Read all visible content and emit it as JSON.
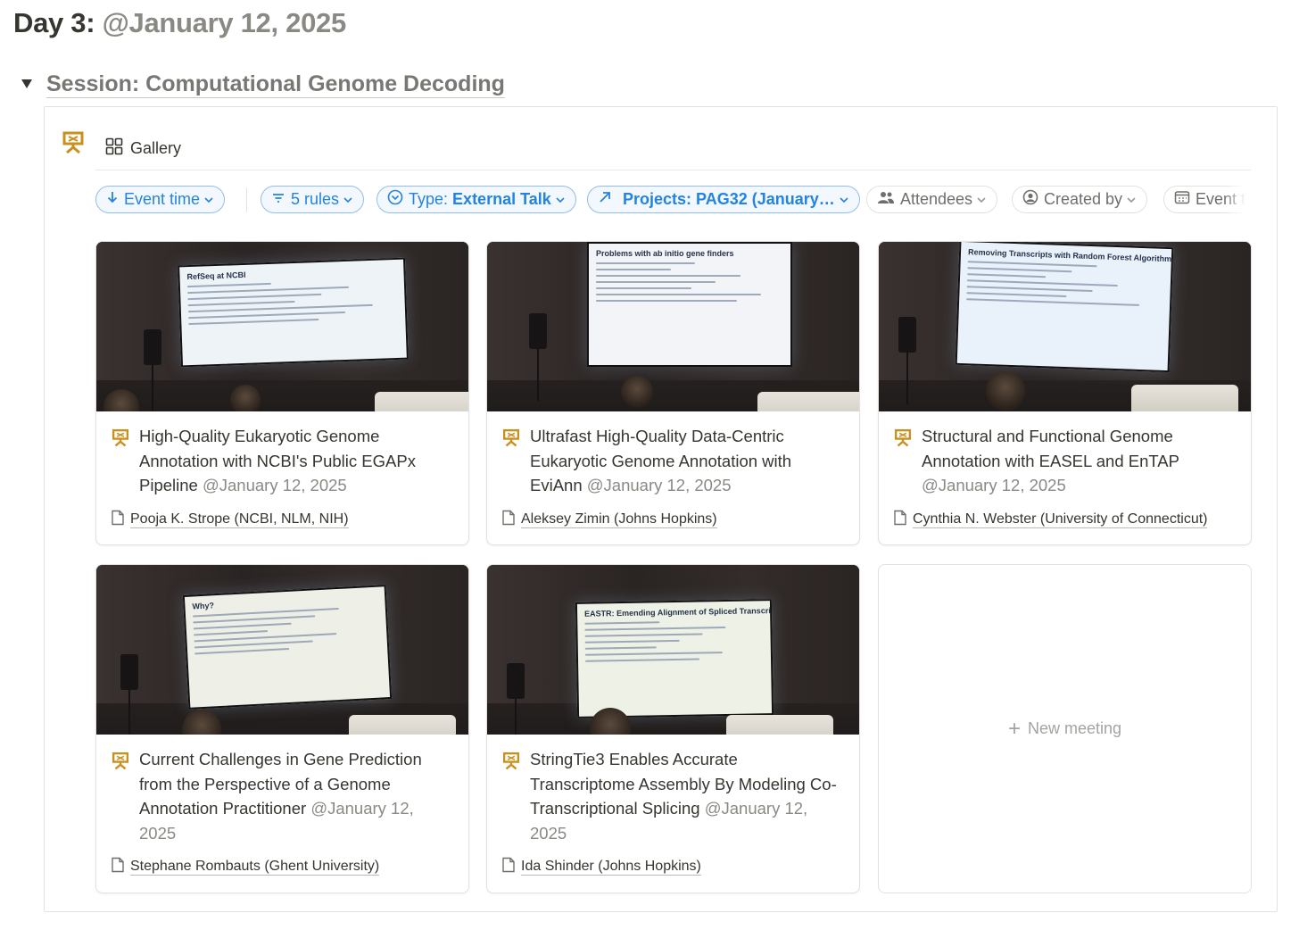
{
  "heading": {
    "label": "Day 3:",
    "date": "@January 12, 2025"
  },
  "session": {
    "title": "Session: Computational Genome Decoding"
  },
  "database": {
    "view_label": "Gallery",
    "icon": "presentation-icon",
    "icon_color": "#c8901f"
  },
  "filters": [
    {
      "icon": "arrow-down-icon",
      "label": "Event time",
      "active": true
    },
    {
      "icon": "filter-icon",
      "label": "5 rules",
      "active": true
    },
    {
      "icon": "status-icon",
      "prop": "Type:",
      "value": "External Talk",
      "active": true
    },
    {
      "icon": "relation-arrow-icon",
      "prop": "Projects:",
      "value": "PAG32 (January…",
      "active": true
    },
    {
      "icon": "people-icon",
      "label": "Attendees",
      "active": false
    },
    {
      "icon": "person-circle-icon",
      "label": "Created by",
      "active": false
    },
    {
      "icon": "calendar-icon",
      "label": "Event t",
      "active": false
    }
  ],
  "cards": [
    {
      "title": "High-Quality Eukaryotic Genome Annotation with NCBI's Public EGAPx Pipeline",
      "date": "@January 12, 2025",
      "person": "Pooja K. Strope (NCBI, NLM, NIH)",
      "slide_title": "RefSeq at NCBI",
      "slide_color": "#eef3f7"
    },
    {
      "title": "Ultrafast High-Quality Data-Centric Eukaryotic Genome Annotation with EviAnn",
      "date": "@January 12, 2025",
      "person": "Aleksey Zimin (Johns Hopkins)",
      "slide_title": "Problems with ab initio gene finders",
      "slide_color": "#f2f4f8"
    },
    {
      "title": "Structural and Functional Genome Annotation with EASEL and EnTAP",
      "date": "@January 12, 2025",
      "person": "Cynthia N. Webster (University of Connecticut)",
      "slide_title": "Removing Transcripts with Random Forest Algorithm",
      "slide_color": "#e9f1fa"
    },
    {
      "title": "Current Challenges in Gene Prediction from the Perspective of a Genome Annotation Practitioner",
      "date": "@January 12, 2025",
      "person": "Stephane Rombauts (Ghent University)",
      "slide_title": "Why?",
      "slide_color": "#eef0e8"
    },
    {
      "title": "StringTie3 Enables Accurate Transcriptome Assembly By Modeling Co-Transcriptional Splicing",
      "date": "@January 12, 2025",
      "person": "Ida Shinder (Johns Hopkins)",
      "slide_title": "EASTR: Emending Alignment of Spliced Transcript Reads",
      "slide_color": "#eef2e6"
    }
  ],
  "new_item": {
    "label": "New meeting"
  }
}
